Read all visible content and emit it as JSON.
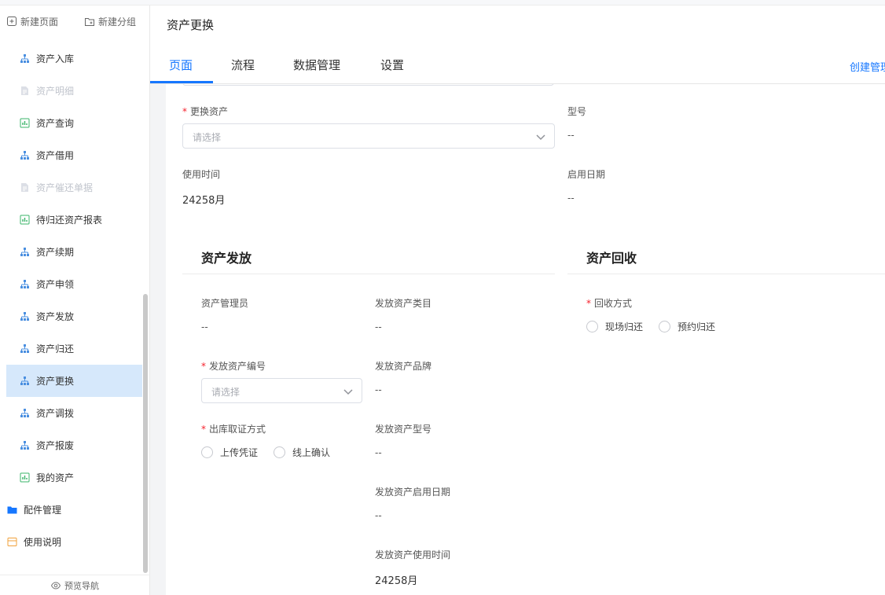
{
  "sidebar": {
    "new_page": "新建页面",
    "new_group": "新建分组",
    "items": [
      {
        "label": "资产入库",
        "icon": "org-icon"
      },
      {
        "label": "资产明细",
        "icon": "doc-icon"
      },
      {
        "label": "资产查询",
        "icon": "report-icon"
      },
      {
        "label": "资产借用",
        "icon": "org-icon"
      },
      {
        "label": "资产催还单据",
        "icon": "doc-icon"
      },
      {
        "label": "待归还资产报表",
        "icon": "report-icon"
      },
      {
        "label": "资产续期",
        "icon": "org-icon"
      },
      {
        "label": "资产申领",
        "icon": "org-icon"
      },
      {
        "label": "资产发放",
        "icon": "org-icon"
      },
      {
        "label": "资产归还",
        "icon": "org-icon"
      },
      {
        "label": "资产更换",
        "icon": "org-icon"
      },
      {
        "label": "资产调拨",
        "icon": "org-icon"
      },
      {
        "label": "资产报废",
        "icon": "org-icon"
      },
      {
        "label": "我的资产",
        "icon": "report-icon"
      },
      {
        "label": "配件管理",
        "icon": "folder-icon"
      },
      {
        "label": "使用说明",
        "icon": "book-icon"
      }
    ],
    "footer": "预览导航"
  },
  "header": {
    "title": "资产更换",
    "tabs": [
      "页面",
      "流程",
      "数据管理",
      "设置"
    ],
    "active_tab": "页面",
    "right_link": "创建管理"
  },
  "form": {
    "replace_asset_label": "更换资产",
    "replace_asset_placeholder": "请选择",
    "model_label": "型号",
    "model_value": "--",
    "use_time_label": "使用时间",
    "use_time_value": "24258月",
    "start_date_label": "启用日期",
    "start_date_value": "--",
    "issue": {
      "title": "资产发放",
      "admin_label": "资产管理员",
      "admin_value": "--",
      "category_label": "发放资产类目",
      "category_value": "--",
      "code_label": "发放资产编号",
      "code_placeholder": "请选择",
      "brand_label": "发放资产品牌",
      "brand_value": "--",
      "method_label": "出库取证方式",
      "method_options": [
        "上传凭证",
        "线上确认"
      ],
      "model_label": "发放资产型号",
      "model_value": "--",
      "start_label": "发放资产启用日期",
      "start_value": "--",
      "use_time_label": "发放资产使用时间",
      "use_time_value": "24258月"
    },
    "recycle": {
      "title": "资产回收",
      "method_label": "回收方式",
      "method_options": [
        "现场归还",
        "预约归还"
      ]
    }
  },
  "colors": {
    "accent": "#1677ff",
    "active_bg": "#d6e8fb",
    "required": "#f5222d"
  }
}
